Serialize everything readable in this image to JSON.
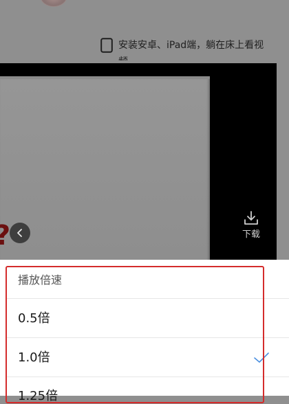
{
  "promo": {
    "text": "安装安卓、iPad端，躺在床上看视频"
  },
  "player": {
    "download_label": "下载"
  },
  "speed_sheet": {
    "title": "播放倍速",
    "options": [
      {
        "label": "0.5倍",
        "selected": false
      },
      {
        "label": "1.0倍",
        "selected": true
      },
      {
        "label": "1.25倍",
        "selected": false
      }
    ]
  },
  "colors": {
    "highlight": "#d42b2b",
    "check": "#4a8fe0"
  },
  "icons": {
    "tablet": "tablet-icon",
    "back": "chevron-left-icon",
    "download": "download-icon",
    "check": "check-icon"
  }
}
